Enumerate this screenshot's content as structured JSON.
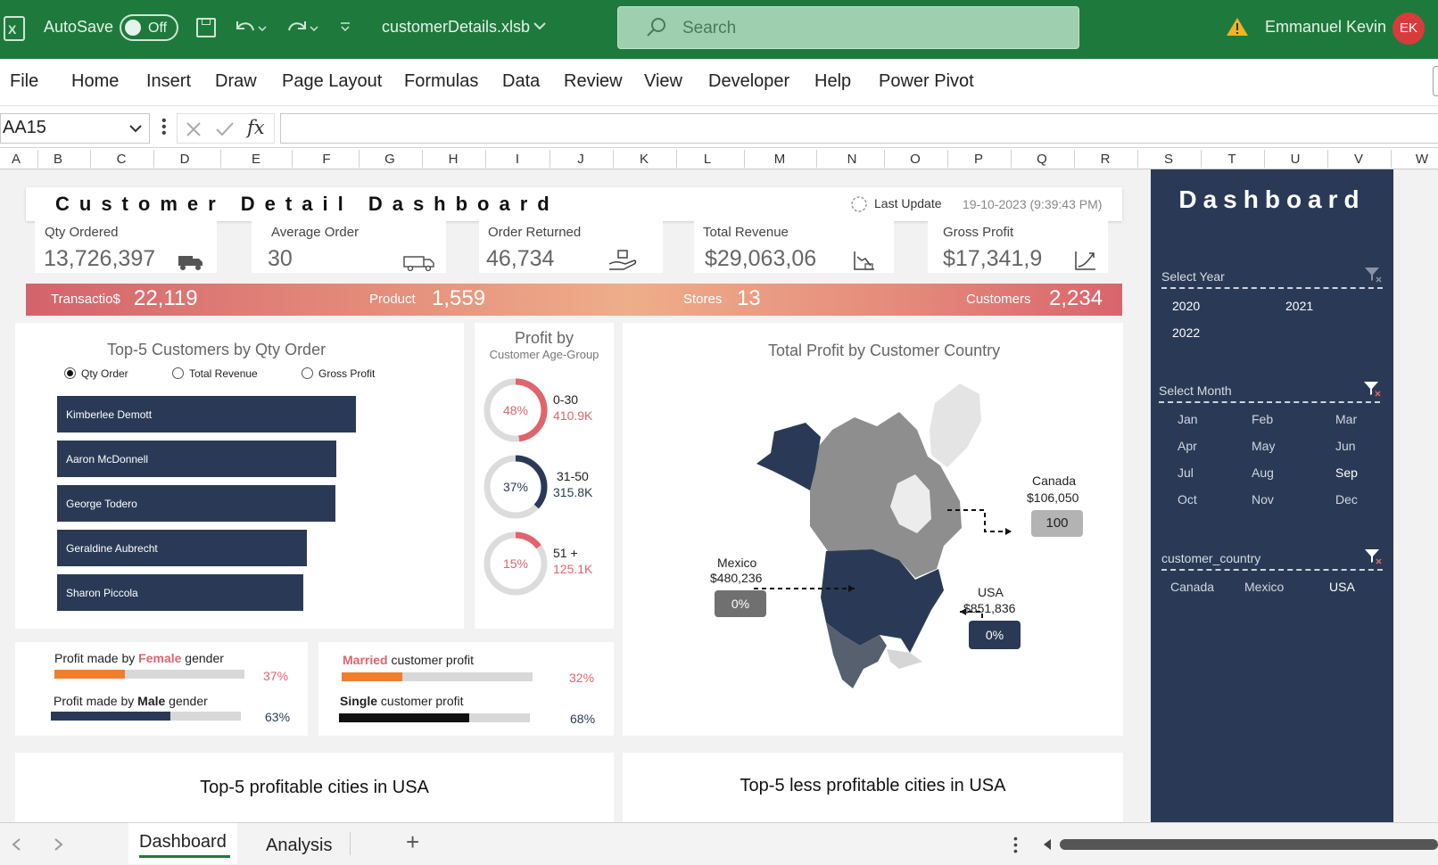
{
  "titlebar": {
    "autosave_label": "AutoSave",
    "autosave_state": "Off",
    "filename": "customerDetails.xlsb",
    "search_placeholder": "Search",
    "user_name": "Emmanuel Kevin",
    "user_initials": "EK"
  },
  "ribbon": {
    "tabs": [
      "File",
      "Home",
      "Insert",
      "Draw",
      "Page Layout",
      "Formulas",
      "Data",
      "Review",
      "View",
      "Developer",
      "Help",
      "Power Pivot"
    ]
  },
  "formula_bar": {
    "name_box": "AA15",
    "fx": "fx",
    "formula": ""
  },
  "columns": [
    "A",
    "B",
    "C",
    "D",
    "E",
    "F",
    "G",
    "H",
    "I",
    "J",
    "K",
    "L",
    "M",
    "N",
    "O",
    "P",
    "Q",
    "R",
    "S",
    "T",
    "U",
    "V",
    "W"
  ],
  "dashboard": {
    "title": "Customer Detail Dashboard",
    "last_update_label": "Last Update",
    "last_update_value": "19-10-2023 (9:39:43 PM)",
    "kpis": [
      {
        "label": "Qty Ordered",
        "value": "13,726,397",
        "icon": "truck-icon"
      },
      {
        "label": "Average Order",
        "value": "30",
        "icon": "delivery-van-icon"
      },
      {
        "label": "Order Returned",
        "value": "46,734",
        "icon": "hand-package-icon"
      },
      {
        "label": "Total Revenue",
        "value": "$29,063,06",
        "icon": "revenue-chart-icon"
      },
      {
        "label": "Gross Profit",
        "value": "$17,341,9",
        "icon": "growth-icon"
      }
    ],
    "band": [
      {
        "label": "Transactio$",
        "value": "22,119"
      },
      {
        "label": "Product",
        "value": "1,559"
      },
      {
        "label": "Stores",
        "value": "13"
      },
      {
        "label": "Customers",
        "value": "2,234"
      }
    ],
    "top5": {
      "title": "Top-5 Customers by Qty Order",
      "options": [
        "Qty Order",
        "Total Revenue",
        "Gross Profit"
      ],
      "selected_option": "Qty Order"
    },
    "age_group": {
      "title": "Profit by",
      "subtitle": "Customer Age-Group",
      "groups": [
        {
          "label": "0-30",
          "value": "410.9K",
          "pct_text": "48%",
          "pct": 48,
          "color": "#e0646b"
        },
        {
          "label": "31-50",
          "value": "315.8K",
          "pct_text": "37%",
          "pct": 37,
          "color": "#2a3a56"
        },
        {
          "label": "51 +",
          "value": "125.1K",
          "pct_text": "15%",
          "pct": 15,
          "color": "#e0646b"
        }
      ]
    },
    "map": {
      "title": "Total Profit by Customer Country",
      "countries": [
        {
          "name": "Canada",
          "value": "$106,050",
          "badge": "100"
        },
        {
          "name": "Mexico",
          "value": "$480,236",
          "badge": "0%"
        },
        {
          "name": "USA",
          "value": "$851,836",
          "badge": "0%"
        }
      ]
    },
    "gender": {
      "female": {
        "prefix": "Profit made by ",
        "hl": "Female",
        "suffix": " gender",
        "pct_text": "37%",
        "pct": 37
      },
      "male": {
        "prefix": "Profit made by ",
        "hl": "Male",
        "suffix": " gender",
        "pct_text": "63%",
        "pct": 63
      }
    },
    "marital": {
      "married": {
        "hl": "Married",
        "suffix": " customer profit",
        "pct_text": "32%",
        "pct": 32
      },
      "single": {
        "hl": "Single",
        "suffix": " customer profit",
        "pct_text": "68%",
        "pct": 68
      }
    },
    "cities_top": "Top-5 profitable cities in USA",
    "cities_bottom": "Top-5 less profitable cities in USA"
  },
  "chart_data": {
    "type": "bar",
    "title": "Top-5 Customers by Qty Order",
    "categories": [
      "Kimberlee Demott",
      "Aaron McDonnell",
      "George Todero",
      "Geraldine Aubrecht",
      "Sharon Piccola"
    ],
    "values": [
      100,
      93.5,
      93,
      83.5,
      82.3
    ],
    "xlabel": "",
    "ylabel": ""
  },
  "pane": {
    "title": "Dashboard",
    "year": {
      "header": "Select Year",
      "items": [
        "2020",
        "2021",
        "2022"
      ]
    },
    "month": {
      "header": "Select Month",
      "items": [
        "Jan",
        "Feb",
        "Mar",
        "Apr",
        "May",
        "Jun",
        "Jul",
        "Aug",
        "Sep",
        "Oct",
        "Nov",
        "Dec"
      ],
      "selected": "Sep"
    },
    "country": {
      "header": "customer_country",
      "items": [
        "Canada",
        "Mexico",
        "USA"
      ],
      "selected": "USA"
    }
  },
  "sheets": {
    "tabs": [
      "Dashboard",
      "Analysis"
    ],
    "active": "Dashboard",
    "add": "+"
  }
}
